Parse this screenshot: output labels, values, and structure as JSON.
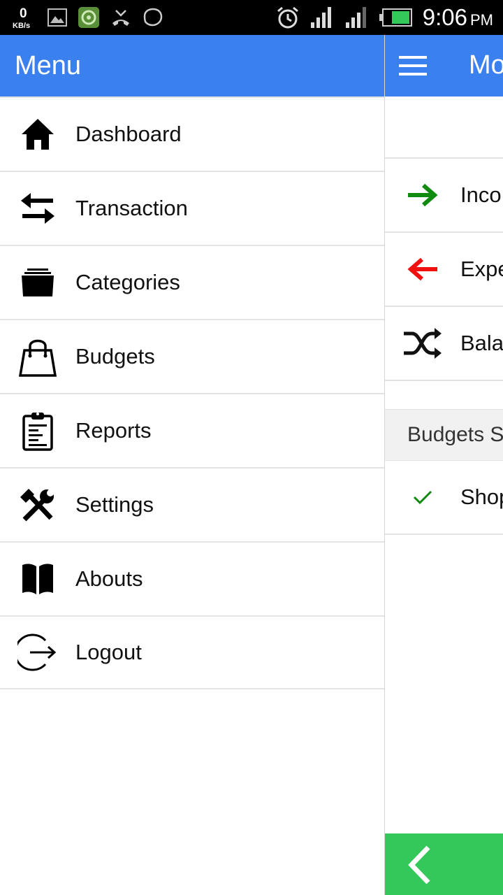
{
  "status_bar": {
    "net_speed_value": "0",
    "net_speed_unit": "KB/s",
    "time": "9:06",
    "ampm": "PM",
    "icons": [
      "gallery-icon",
      "app-icon",
      "missed-call-icon",
      "chat-icon",
      "alarm-icon",
      "signal-icon",
      "signal-icon",
      "battery-icon"
    ]
  },
  "drawer": {
    "title": "Menu",
    "items": [
      {
        "label": "Dashboard",
        "icon": "home-icon"
      },
      {
        "label": "Transaction",
        "icon": "transfer-arrows-icon"
      },
      {
        "label": "Categories",
        "icon": "folder-box-icon"
      },
      {
        "label": "Budgets",
        "icon": "shopping-bag-icon"
      },
      {
        "label": "Reports",
        "icon": "clipboard-icon"
      },
      {
        "label": "Settings",
        "icon": "tools-icon"
      },
      {
        "label": "Abouts",
        "icon": "book-icon"
      },
      {
        "label": "Logout",
        "icon": "logout-icon"
      }
    ]
  },
  "main": {
    "title": "Mo",
    "rows": [
      {
        "label": "Inco",
        "icon": "arrow-right-icon",
        "color": "#118a11"
      },
      {
        "label": "Expe",
        "icon": "arrow-left-icon",
        "color": "#f01010"
      },
      {
        "label": "Balar",
        "icon": "shuffle-icon",
        "color": "#111111"
      }
    ],
    "section_header": "Budgets S",
    "budget_item": {
      "label": "Shop",
      "icon": "check-icon",
      "color": "#118a11"
    }
  },
  "colors": {
    "header_blue": "#3b80ef",
    "fab_green": "#34c85a",
    "divider": "#e3e3e3"
  }
}
